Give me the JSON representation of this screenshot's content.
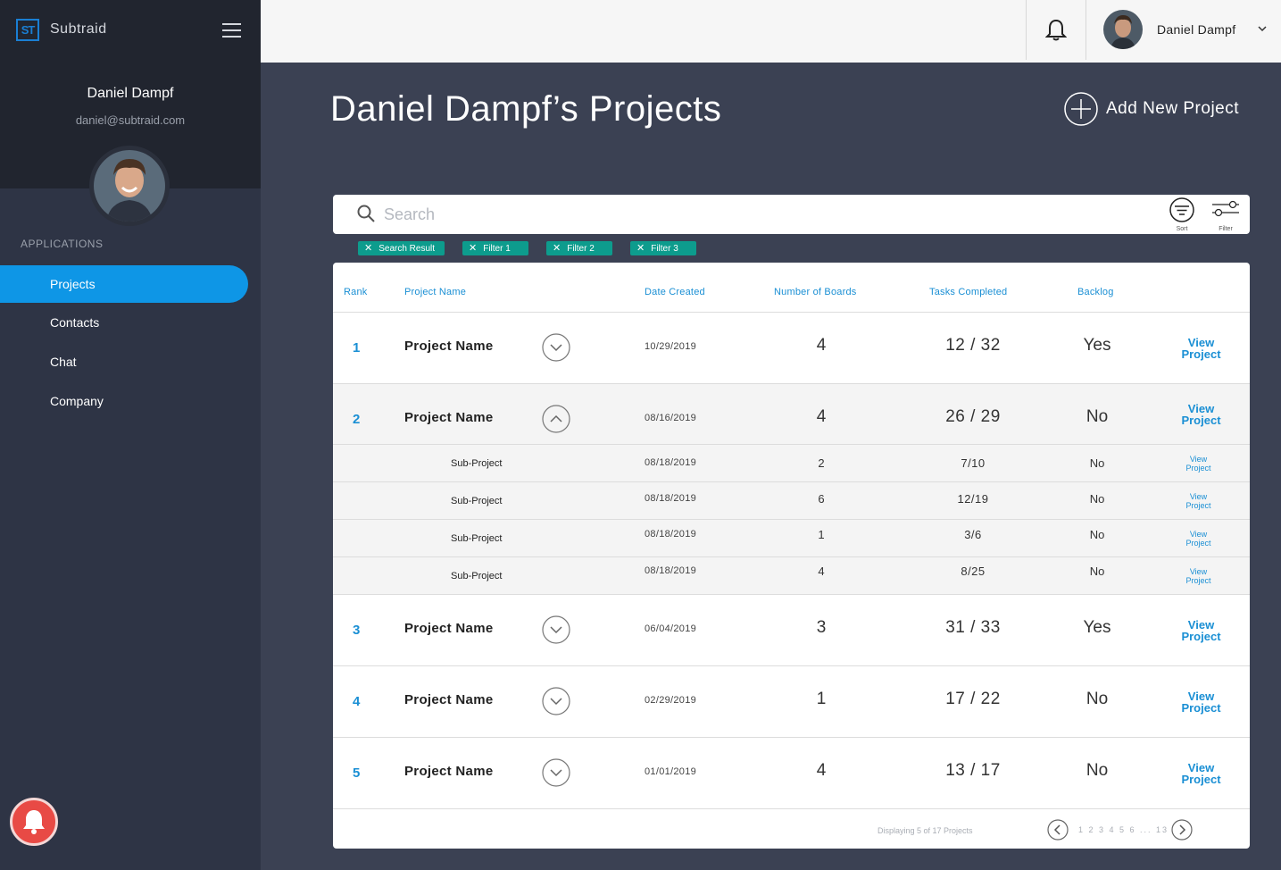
{
  "brand": {
    "logo_text": "ST",
    "name": "Subtraid"
  },
  "sidebar": {
    "user_name": "Daniel Dampf",
    "user_email": "daniel@subtraid.com",
    "section_label": "APPLICATIONS",
    "items": [
      {
        "label": "Projects",
        "active": true
      },
      {
        "label": "Contacts",
        "active": false
      },
      {
        "label": "Chat",
        "active": false
      },
      {
        "label": "Company",
        "active": false
      }
    ]
  },
  "topbar": {
    "user_name": "Daniel Dampf"
  },
  "page": {
    "title": "Daniel Dampf’s Projects",
    "add_button": "Add New Project"
  },
  "search": {
    "placeholder": "Search",
    "sort_label": "Sort",
    "filter_label": "Filter"
  },
  "chips": [
    "Search Result",
    "Filter 1",
    "Filter 2",
    "Filter 3"
  ],
  "table": {
    "headers": {
      "rank": "Rank",
      "name": "Project Name",
      "date": "Date Created",
      "boards": "Number of Boards",
      "tasks": "Tasks Completed",
      "backlog": "Backlog"
    },
    "rows": [
      {
        "rank": "1",
        "name": "Project Name",
        "date": "10/29/2019",
        "boards": "4",
        "tasks": "12 / 32",
        "backlog": "Yes",
        "view1": "View",
        "view2": "Project"
      },
      {
        "rank": "2",
        "name": "Project Name",
        "date": "08/16/2019",
        "boards": "4",
        "tasks": "26 / 29",
        "backlog": "No",
        "view1": "View",
        "view2": "Project"
      },
      {
        "rank": "3",
        "name": "Project Name",
        "date": "06/04/2019",
        "boards": "3",
        "tasks": "31 / 33",
        "backlog": "Yes",
        "view1": "View",
        "view2": "Project"
      },
      {
        "rank": "4",
        "name": "Project Name",
        "date": "02/29/2019",
        "boards": "1",
        "tasks": "17 / 22",
        "backlog": "No",
        "view1": "View",
        "view2": "Project"
      },
      {
        "rank": "5",
        "name": "Project Name",
        "date": "01/01/2019",
        "boards": "4",
        "tasks": "13 / 17",
        "backlog": "No",
        "view1": "View",
        "view2": "Project"
      }
    ],
    "subrows": [
      {
        "name": "Sub-Project",
        "date": "08/18/2019",
        "boards": "2",
        "tasks": "7/10",
        "backlog": "No",
        "view1": "View",
        "view2": "Project"
      },
      {
        "name": "Sub-Project",
        "date": "08/18/2019",
        "boards": "6",
        "tasks": "12/19",
        "backlog": "No",
        "view1": "View",
        "view2": "Project"
      },
      {
        "name": "Sub-Project",
        "date": "08/18/2019",
        "boards": "1",
        "tasks": "3/6",
        "backlog": "No",
        "view1": "View",
        "view2": "Project"
      },
      {
        "name": "Sub-Project",
        "date": "08/18/2019",
        "boards": "4",
        "tasks": "8/25",
        "backlog": "No",
        "view1": "View",
        "view2": "Project"
      }
    ]
  },
  "footer": {
    "displaying": "Displaying 5 of 17 Projects",
    "pages": "1 2 3 4 5 6 ... 13"
  },
  "colors": {
    "accent": "#0e96e6",
    "chip": "#0d9c8d",
    "sidebar": "#2e3445",
    "main_bg": "#3b4153",
    "alert": "#e84a45"
  }
}
